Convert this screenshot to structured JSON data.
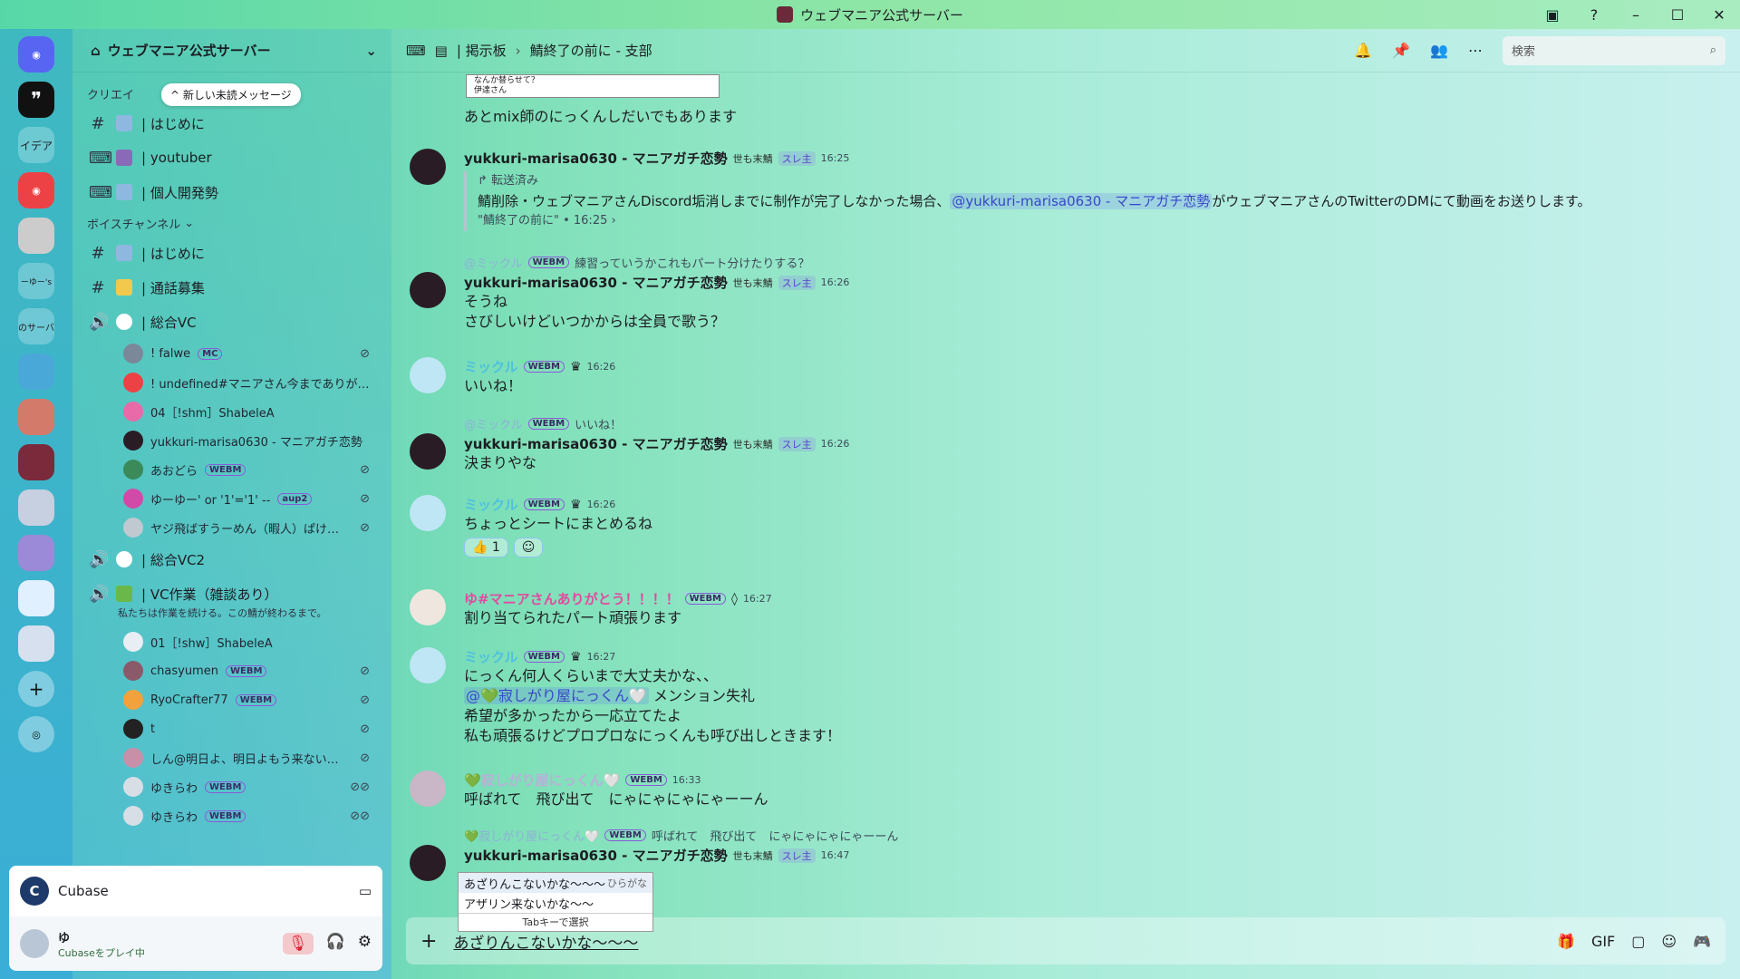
{
  "window": {
    "title": "ウェブマニア公式サーバー"
  },
  "rail": {
    "items": [
      "イデア",
      "ーゆー's",
      "のサーバ"
    ]
  },
  "server": {
    "name": "ウェブマニア公式サーバー"
  },
  "unread_pill": "新しい未読メッセージ",
  "categories": {
    "top": "クリエイ",
    "voice": "ボイスチャンネル"
  },
  "channels": [
    {
      "name": "| はじめに"
    },
    {
      "name": "| youtuber"
    },
    {
      "name": "| 個人開発勢"
    },
    {
      "name": "| はじめに"
    },
    {
      "name": "| 通話募集"
    },
    {
      "name": "| 総合VC"
    },
    {
      "name": "| 総合VC2"
    },
    {
      "name": "| VC作業（雑談あり）"
    }
  ],
  "vc_desc": "私たちは作業を続ける。この鯖が終わるまで。",
  "vc1_users": [
    {
      "name": "! falwe",
      "tag": "MC"
    },
    {
      "name": "! undefined#マニアさん今までありが…",
      "tag": ""
    },
    {
      "name": "04［!shm］ShabeleA",
      "tag": ""
    },
    {
      "name": "yukkuri-marisa0630 - マニアガチ恋勢",
      "tag": ""
    },
    {
      "name": "あおどら",
      "tag": "WEBM"
    },
    {
      "name": "ゆーゆー' or '1'='1' --",
      "tag": "aup2"
    },
    {
      "name": "ヤジ飛ばすうーめん（暇人）ぱけ…",
      "tag": ""
    }
  ],
  "vc2_users": [
    {
      "name": "01［!shw］ShabeleA",
      "tag": ""
    },
    {
      "name": "chasyumen",
      "tag": "WEBM"
    },
    {
      "name": "RyoCrafter77",
      "tag": "WEBM"
    },
    {
      "name": "t",
      "tag": ""
    },
    {
      "name": "しん@明日よ、明日よもう来ない…",
      "tag": ""
    },
    {
      "name": "ゆきらわ",
      "tag": "WEBM"
    },
    {
      "name": "ゆきらわ",
      "tag": "WEBM"
    }
  ],
  "activity": {
    "app": "Cubase"
  },
  "user": {
    "name": "ゆ",
    "status": "Cubaseをプレイ中"
  },
  "topbar": {
    "forum": "| 掲示板",
    "thread": "鯖終了の前に - 支部",
    "search_placeholder": "検索"
  },
  "image_snippet": {
    "line1": "なんか替らせて？",
    "line2": "伊達さん"
  },
  "messages": {
    "m0": {
      "text": "あとmix師のにっくんしだいでもあります"
    },
    "m1": {
      "user": "yukkuri-marisa0630 - マニアガチ恋勢",
      "badge": "世も末鯖",
      "role": "スレ主",
      "time": "16:25",
      "fwd_label": "転送済み",
      "fwd_pre": "鯖削除・ウェブマニアさんDiscord垢消しまでに制作が完了しなかった場合、",
      "fwd_mention": "@yukkuri-marisa0630 - マニアガチ恋勢",
      "fwd_post": "がウェブマニアさんのTwitterのDMにて動画をお送りします。",
      "fwd_meta": "\"鯖終了の前に\" • 16:25 ›"
    },
    "m2": {
      "reply_user": "@ミックル",
      "reply_tag": "WEBM",
      "reply_text": "練習っていうかこれもパート分けたりする？",
      "user": "yukkuri-marisa0630 - マニアガチ恋勢",
      "badge": "世も末鯖",
      "role": "スレ主",
      "time": "16:26",
      "l1": "そうね",
      "l2": "さびしいけどいつかからは全員で歌う？"
    },
    "m3": {
      "user": "ミックル",
      "tag": "WEBM",
      "time": "16:26",
      "text": "いいね！"
    },
    "m4": {
      "reply_user": "@ミックル",
      "reply_tag": "WEBM",
      "reply_text": "いいね！",
      "user": "yukkuri-marisa0630 - マニアガチ恋勢",
      "badge": "世も末鯖",
      "role": "スレ主",
      "time": "16:26",
      "text": "決まりやな"
    },
    "m5": {
      "user": "ミックル",
      "tag": "WEBM",
      "time": "16:26",
      "text": "ちょっとシートにまとめるね",
      "reaction": "👍 1"
    },
    "m6": {
      "user": "ゆ#マニアさんありがとう！！！！",
      "tag": "WEBM",
      "time": "16:27",
      "text": "割り当てられたパート頑張ります"
    },
    "m7": {
      "user": "ミックル",
      "tag": "WEBM",
      "time": "16:27",
      "l1": "にっくん何人くらいまで大丈夫かな、、",
      "mention": "@💚寂しがり屋にっくん🤍",
      "l2_post": " メンション失礼",
      "l3": "希望が多かったから一応立てたよ",
      "l4": "私も頑張るけどプロプロなにっくんも呼び出しときます！"
    },
    "m8": {
      "user": "💚寂しがり屋にっくん🤍",
      "tag": "WEBM",
      "time": "16:33",
      "text": "呼ばれて　飛び出て　にゃにゃにゃにゃーーん"
    },
    "m9": {
      "reply_user": "💚寂しがり屋にっくん🤍",
      "reply_tag": "WEBM",
      "reply_text": "呼ばれて　飛び出て　にゃにゃにゃにゃーーん",
      "user": "yukkuri-marisa0630 - マニアガチ恋勢",
      "badge": "世も末鯖",
      "role": "スレ主",
      "time": "16:47"
    }
  },
  "ime": {
    "opt1": "あざりんこないかな～～～",
    "opt1_hint": "ひらがな",
    "opt2": "アザリン来ないかな～～",
    "footer": "Tabキーで選択"
  },
  "composer": {
    "value": "あざりんこないかな～～～"
  }
}
